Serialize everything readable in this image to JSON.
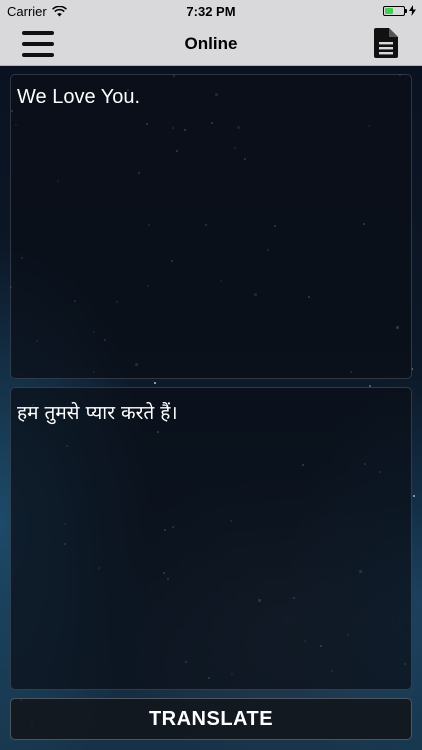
{
  "status_bar": {
    "carrier": "Carrier",
    "time": "7:32 PM",
    "battery_level": 0.45
  },
  "nav": {
    "title": "Online",
    "left_icon": "hamburger-menu-icon",
    "right_icon": "document-icon"
  },
  "source_panel": {
    "text": "We Love You."
  },
  "target_panel": {
    "text": "हम तुमसे प्यार करते हैं।"
  },
  "translate_button": {
    "label": "TRANSLATE"
  },
  "colors": {
    "bar_background": "#d9d9db",
    "battery_fill": "#3fd04f",
    "panel_background": "#0a0e16",
    "text": "#ffffff"
  }
}
